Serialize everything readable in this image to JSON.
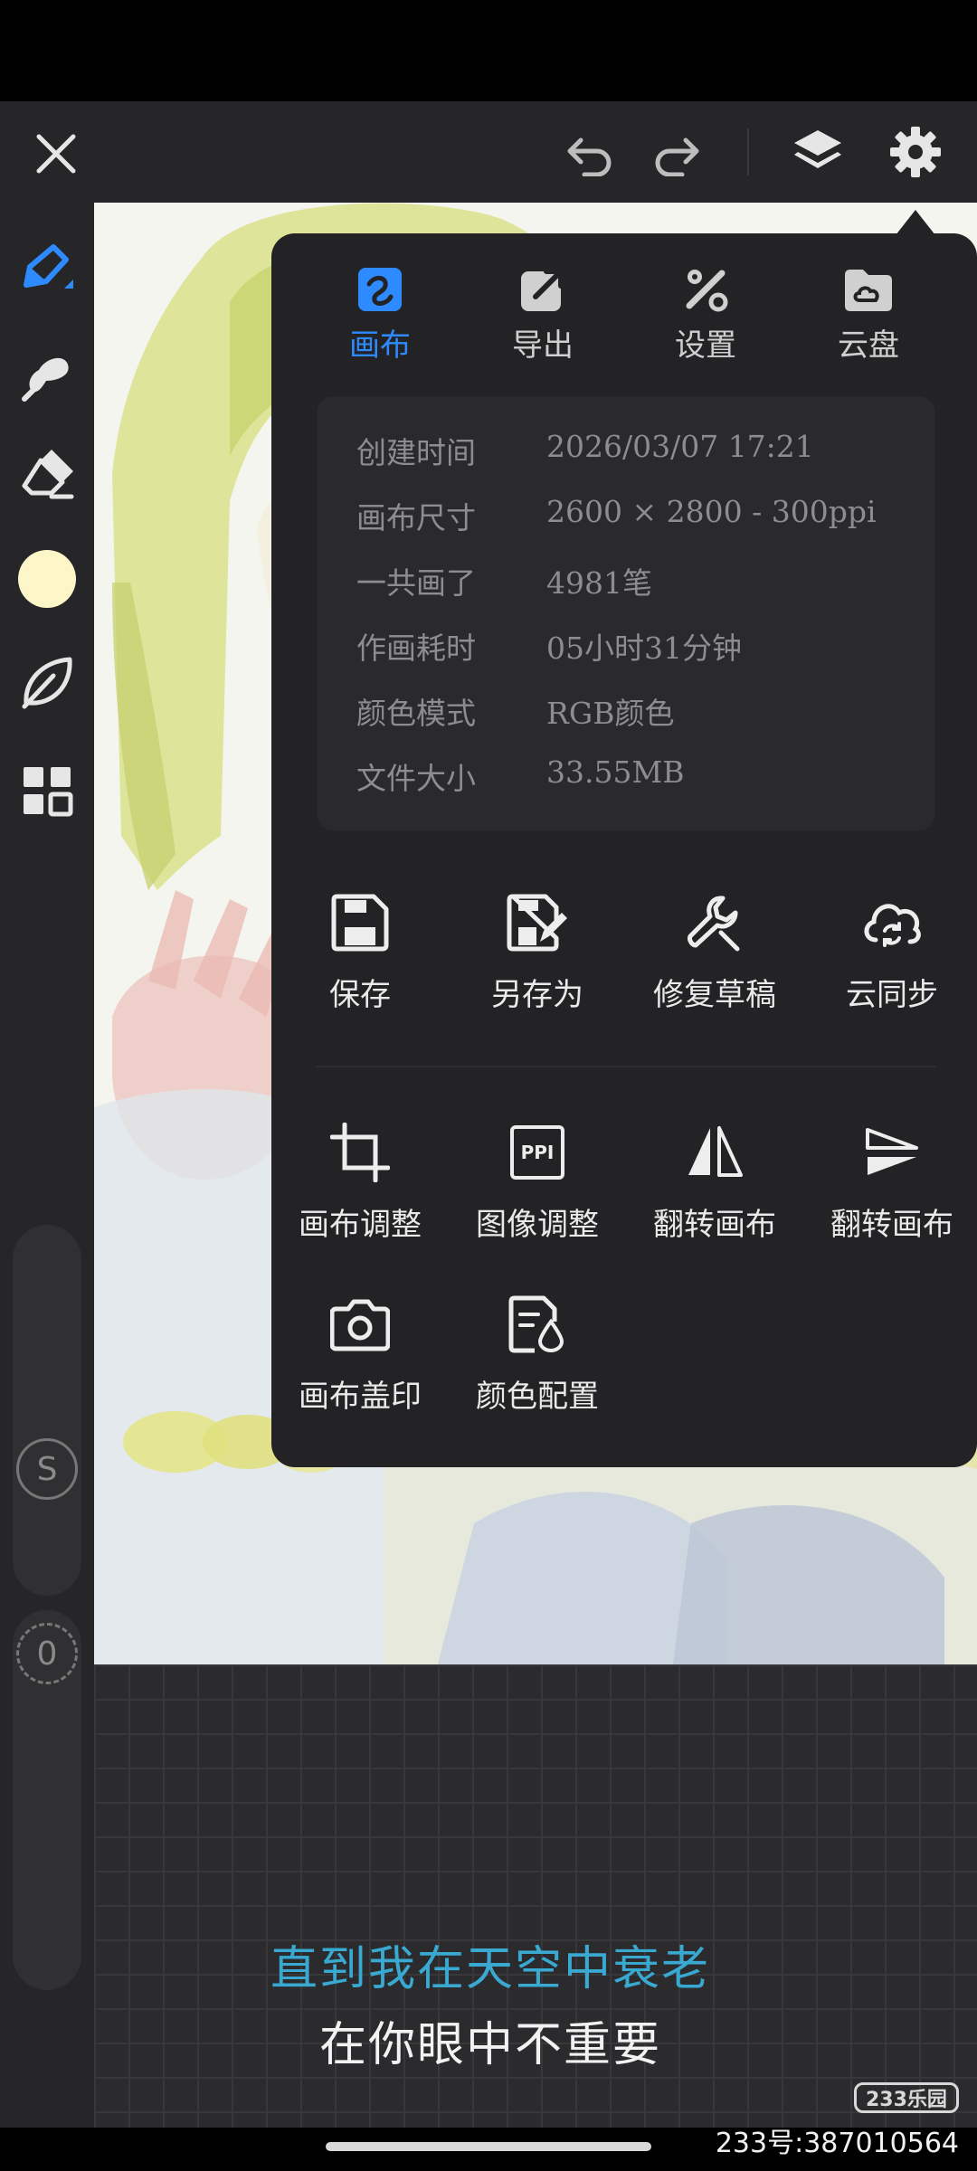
{
  "toolbar": {
    "close_icon": "close-icon",
    "undo_icon": "undo-icon",
    "redo_icon": "redo-icon",
    "layers_icon": "layers-icon",
    "settings_icon": "gear-icon"
  },
  "sidebar": {
    "tools": [
      "brush-icon",
      "smudge-icon",
      "eraser-icon",
      "color-swatch",
      "leaf-icon",
      "grid-icon"
    ],
    "current_color": "#fdf6c8",
    "size_slider_label": "S",
    "opacity_slider_label": "0"
  },
  "popup": {
    "tabs": [
      {
        "label": "画布",
        "active": true
      },
      {
        "label": "导出"
      },
      {
        "label": "设置"
      },
      {
        "label": "云盘"
      }
    ],
    "info": [
      {
        "label": "创建时间",
        "value": "2026/03/07 17:21"
      },
      {
        "label": "画布尺寸",
        "value": "2600 × 2800 - 300ppi"
      },
      {
        "label": "一共画了",
        "value": "4981笔"
      },
      {
        "label": "作画耗时",
        "value": "05小时31分钟"
      },
      {
        "label": "颜色模式",
        "value": "RGB颜色"
      },
      {
        "label": "文件大小",
        "value": "33.55MB"
      }
    ],
    "actions_row1": [
      {
        "label": "保存"
      },
      {
        "label": "另存为"
      },
      {
        "label": "修复草稿"
      },
      {
        "label": "云同步"
      }
    ],
    "actions_row2": [
      {
        "label": "画布调整"
      },
      {
        "label": "图像调整",
        "icon_text": "PPI"
      },
      {
        "label": "翻转画布"
      },
      {
        "label": "翻转画布"
      }
    ],
    "actions_row3": [
      {
        "label": "画布盖印"
      },
      {
        "label": "颜色配置"
      }
    ]
  },
  "lyrics": {
    "line1": "直到我在天空中衰老",
    "line2": "在你眼中不重要"
  },
  "watermark": {
    "badge": "233乐园",
    "id": "233号:387010564"
  },
  "colors": {
    "accent": "#2e8bff",
    "lyric_highlight": "#39a9d2"
  }
}
